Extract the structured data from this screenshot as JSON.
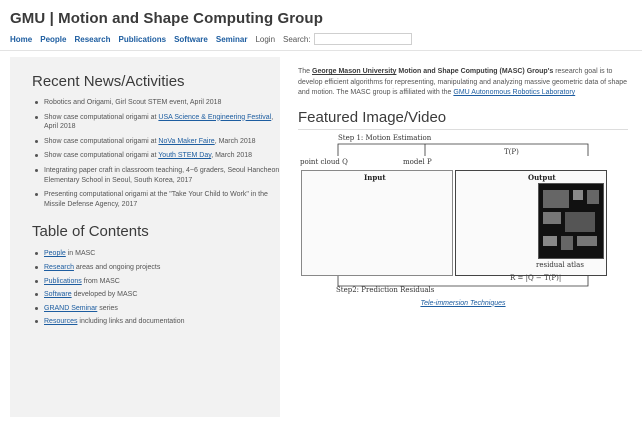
{
  "site": {
    "title": "GMU | Motion and Shape Computing Group"
  },
  "nav": {
    "items": [
      "Home",
      "People",
      "Research",
      "Publications",
      "Software",
      "Seminar"
    ],
    "login": "Login",
    "search_label": "Search:",
    "search_value": ""
  },
  "news": {
    "title": "Recent News/Activities",
    "items": [
      {
        "before": "Robotics and Origami, Girl Scout STEM event, April 2018",
        "link": "",
        "after": ""
      },
      {
        "before": "Show case computational origami at ",
        "link": "USA Science & Engineering Festival",
        "after": ", April 2018"
      },
      {
        "before": "Show case computational origami at ",
        "link": "NoVa Maker Faire",
        "after": ", March 2018"
      },
      {
        "before": "Show case computational origami at ",
        "link": "Youth STEM Day",
        "after": ", March 2018"
      },
      {
        "before": "Integrating paper craft in classroom teaching, 4~6 graders, Seoul Hancheon Elementary School in Seoul, South Korea, 2017",
        "link": "",
        "after": ""
      },
      {
        "before": "Presenting computational origami at the \"Take Your Child to Work\" in the Missile Defense Agency, 2017",
        "link": "",
        "after": ""
      }
    ]
  },
  "toc": {
    "title": "Table of Contents",
    "items": [
      {
        "link": "People",
        "after": " in MASC"
      },
      {
        "link": "Research",
        "after": " areas and ongoing projects"
      },
      {
        "link": "Publications",
        "after": " from MASC"
      },
      {
        "link": "Software",
        "after": " developed by MASC"
      },
      {
        "link": "GRAND Seminar",
        "after": " series"
      },
      {
        "link": "Resources",
        "after": " including links and documentation"
      }
    ]
  },
  "intro": {
    "pre": "The ",
    "university_link": "George Mason University",
    "group_name": " Motion and Shape Computing (MASC) Group's",
    "body": " research goal is to develop efficient algorithms for representing, manipulating and analyzing massive geometric data of shape and motion. The MASC group is affiliated with the ",
    "lab_link": "GMU Autonomous Robotics Laboratory"
  },
  "featured": {
    "title": "Featured Image/Video",
    "step1": "Step 1: Motion Estimation",
    "point_cloud": "point cloud Q",
    "model": "model P",
    "transform": "T(P)",
    "input_label": "Input",
    "output_label": "Output",
    "residual_atlas": "residual atlas",
    "equation": "R = |Q − T(P)|",
    "step2": "Step2: Prediction Residuals",
    "caption_link": "Tele-immersion Techniques"
  },
  "colors": {
    "link": "#1d5da0",
    "title": "#3a3a3a",
    "sidebar_bg": "#f2f2f2"
  }
}
